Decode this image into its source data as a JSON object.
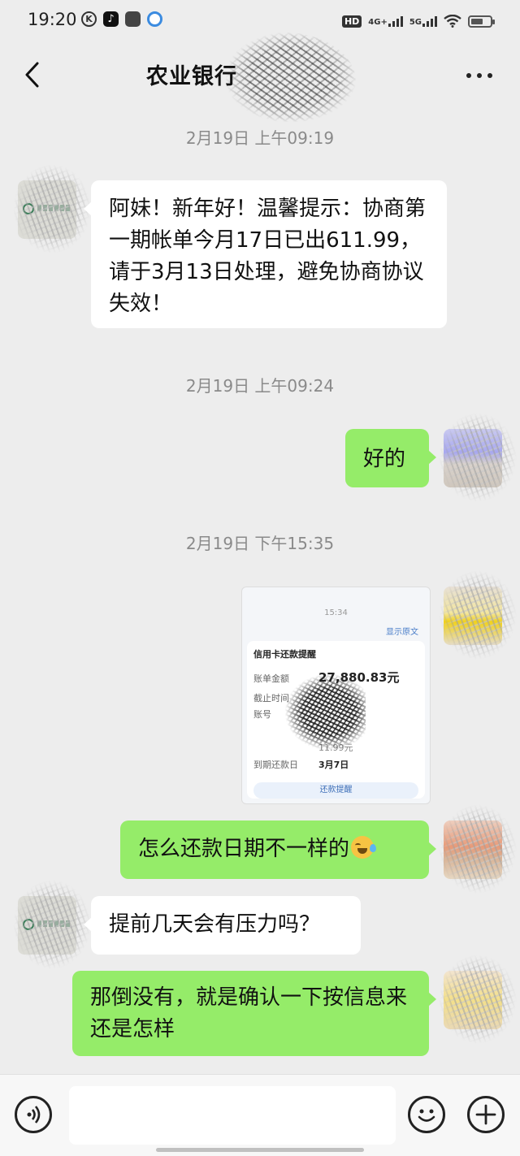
{
  "status_bar": {
    "time": "19:20",
    "network_1": "4G+",
    "network_2": "5G"
  },
  "header": {
    "title": "农业银行"
  },
  "messages": [
    {
      "type": "timestamp",
      "text": "2月19日 上午09:19"
    },
    {
      "type": "text",
      "side": "left",
      "text": "阿妹！新年好！温馨提示：协商第一期帐单今月17日已出611.99，请于3月13日处理，避免协商协议失效！"
    },
    {
      "type": "timestamp",
      "text": "2月19日 上午09:24"
    },
    {
      "type": "text",
      "side": "right",
      "text": "好的"
    },
    {
      "type": "timestamp",
      "text": "2月19日 下午15:35"
    },
    {
      "type": "image",
      "side": "right"
    },
    {
      "type": "text",
      "side": "right",
      "text": "怎么还款日期不一样的"
    },
    {
      "type": "text",
      "side": "left",
      "text": "提前几天会有压力吗？"
    },
    {
      "type": "text",
      "side": "right",
      "text": "那倒没有，就是确认一下按信息来还是怎样"
    }
  ],
  "image_card": {
    "time": "15:34",
    "link": "显示原文",
    "title": "信用卡还款提醒",
    "rows": [
      {
        "label": "账单金额",
        "value": "27,880.83元"
      },
      {
        "label": "截止时间",
        "value": ""
      },
      {
        "label": "账号",
        "value": ""
      },
      {
        "label": "",
        "value": ""
      },
      {
        "label": "",
        "value": "11.99元"
      },
      {
        "label": "到期还款日",
        "value": "3月7日"
      }
    ],
    "button": "还款提醒"
  },
  "input_bar": {
    "placeholder": ""
  },
  "colors": {
    "background": "#ededed",
    "bubble_right": "#95ec69",
    "bubble_left": "#ffffff",
    "timestamp": "#8a8a8a"
  }
}
